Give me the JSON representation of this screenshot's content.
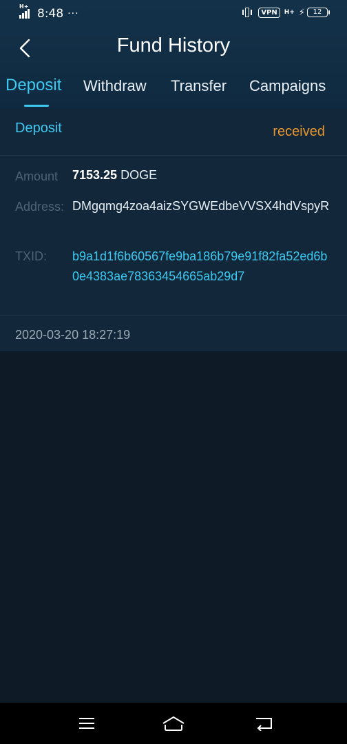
{
  "status_bar": {
    "net_type": "H+",
    "time": "8:48",
    "dots": "···",
    "vpn": "VPN",
    "net_type_right": "H+",
    "battery": "12",
    "icons": [
      "signal-icon",
      "vibrate-icon",
      "vpn-icon",
      "charging-icon",
      "battery-icon"
    ]
  },
  "header": {
    "back_icon": "chevron-left-icon",
    "title": "Fund History"
  },
  "tabs": [
    {
      "label": "Deposit",
      "active": true
    },
    {
      "label": "Withdraw",
      "active": false
    },
    {
      "label": "Transfer",
      "active": false
    },
    {
      "label": "Campaigns",
      "active": false
    }
  ],
  "record": {
    "type": "Deposit",
    "status": "received",
    "amount_label": "Amount",
    "amount_value": "7153.25",
    "amount_unit": "DOGE",
    "address_label": "Address:",
    "address_value": "DMgqmg4zoa4aizSYGWEdbeVVSX4hdVspyR",
    "txid_label": "TXID:",
    "txid_value": "b9a1d1f6b60567fe9ba186b79e91f82fa52ed6b0e4383ae78363454665ab29d7",
    "timestamp": "2020-03-20 18:27:19"
  },
  "nav_bar": {
    "icons": [
      "menu-icon",
      "home-icon",
      "back-icon"
    ]
  },
  "colors": {
    "accent": "#3ec8f0",
    "status_received": "#e8962c",
    "background": "#0e1a26",
    "card": "#12283a"
  }
}
